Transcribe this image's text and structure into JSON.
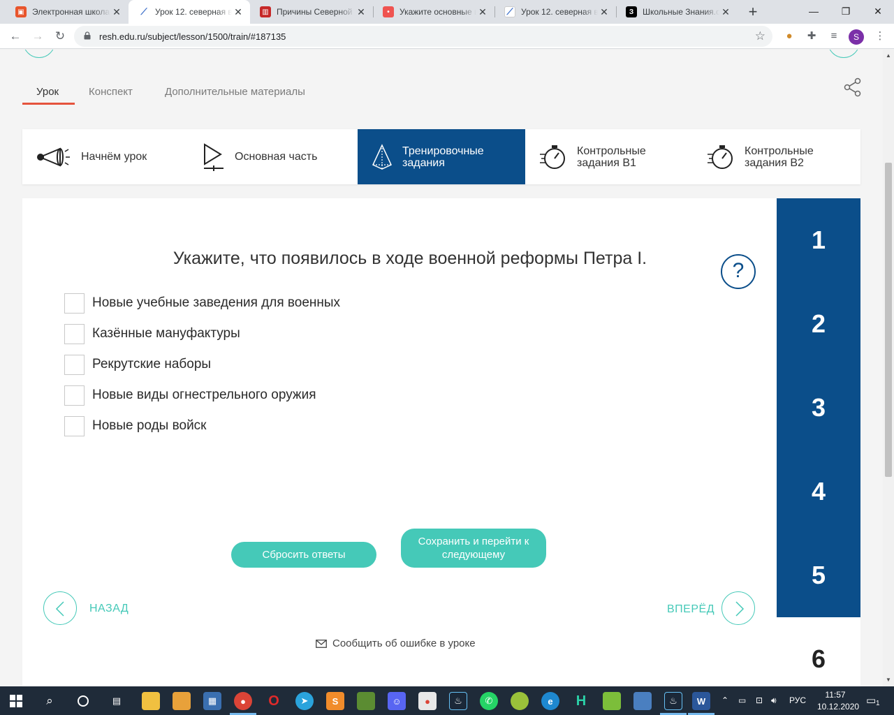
{
  "browser": {
    "tabs": [
      {
        "title": "Электронная школа",
        "icon": "school-favicon",
        "color": "#e8542b",
        "active": false
      },
      {
        "title": "Урок 12. северная в",
        "icon": "resh-favicon",
        "color": "#3b6ec9",
        "active": true
      },
      {
        "title": "Причины Северной",
        "icon": "book-favicon",
        "color": "#c62828",
        "active": false
      },
      {
        "title": "Укажите основные ц",
        "icon": "resh-red-favicon",
        "color": "#ef5350",
        "active": false
      },
      {
        "title": "Урок 12. северная в",
        "icon": "resh-favicon",
        "color": "#3b6ec9",
        "active": false
      },
      {
        "title": "Школьные Знания.с",
        "icon": "znanija-favicon",
        "color": "#000000",
        "active": false
      }
    ],
    "url": "resh.edu.ru/subject/lesson/1500/train/#187135",
    "profile_initial": "S"
  },
  "lesson_tabs": [
    {
      "label": "Урок",
      "active": true
    },
    {
      "label": "Конспект",
      "active": false
    },
    {
      "label": "Дополнительные материалы",
      "active": false
    }
  ],
  "steps": [
    {
      "label": "Начнём урок",
      "icon": "megaphone-icon",
      "active": false
    },
    {
      "label": "Основная часть",
      "icon": "play-icon",
      "active": false
    },
    {
      "label": "Тренировочные задания",
      "line1": "Тренировочные",
      "line2": "задания",
      "icon": "pyramid-icon",
      "active": true
    },
    {
      "label": "Контрольные задания В1",
      "line1": "Контрольные",
      "line2": "задания В1",
      "icon": "stopwatch-icon",
      "active": false
    },
    {
      "label": "Контрольные задания В2",
      "line1": "Контрольные",
      "line2": "задания В2",
      "icon": "stopwatch-icon",
      "active": false
    }
  ],
  "task": {
    "question": "Укажите, что появилось в ходе военной реформы Петра I.",
    "options": [
      {
        "label": "Новые учебные заведения для военных",
        "checked": false
      },
      {
        "label": "Казённые мануфактуры",
        "checked": false
      },
      {
        "label": "Рекрутские наборы",
        "checked": false
      },
      {
        "label": "Новые виды огнестрельного оружия",
        "checked": false
      },
      {
        "label": "Новые роды войск",
        "checked": false
      }
    ],
    "reset_label": "Сбросить ответы",
    "save_label_line1": "Сохранить и перейти к",
    "save_label_line2": "следующему",
    "back_label": "НАЗАД",
    "forward_label": "ВПЕРЁД",
    "report_label": "Сообщить об ошибке в уроке",
    "help_symbol": "?"
  },
  "task_numbers": [
    "1",
    "2",
    "3",
    "4",
    "5",
    "6"
  ],
  "taskbar": {
    "language": "РУС",
    "time": "11:57",
    "date": "10.12.2020",
    "notifications": "1"
  },
  "colors": {
    "primary": "#0b4e8a",
    "accent": "#45c9b8",
    "tab_underline": "#e5533d"
  }
}
